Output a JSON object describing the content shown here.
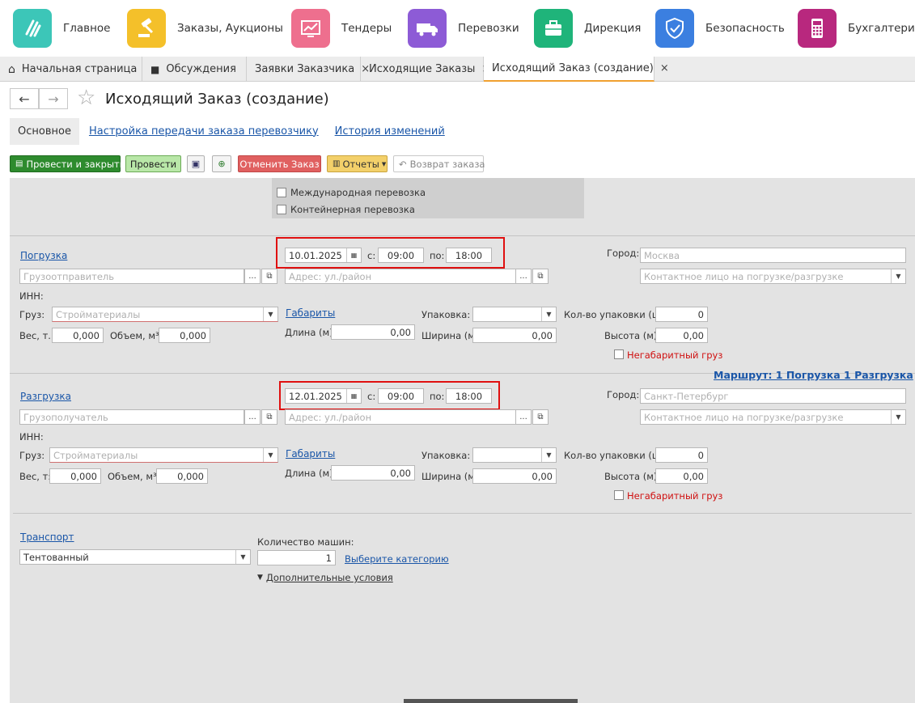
{
  "topnav": {
    "items": [
      {
        "label": "Главное",
        "icon": "main-logo-icon",
        "color": "#3cc6b8"
      },
      {
        "label": "Заказы, Аукционы",
        "icon": "gavel-icon",
        "color": "#f4c02a"
      },
      {
        "label": "Тендеры",
        "icon": "chart-icon",
        "color": "#ee6f8e"
      },
      {
        "label": "Перевозки",
        "icon": "truck-icon",
        "color": "#8d5bd6"
      },
      {
        "label": "Дирекция",
        "icon": "briefcase-icon",
        "color": "#1fb47a"
      },
      {
        "label": "Безопасность",
        "icon": "shield-icon",
        "color": "#3b7fe0"
      },
      {
        "label": "Бухгалтерия",
        "icon": "calculator-icon",
        "color": "#b8287e"
      }
    ]
  },
  "tabs": [
    {
      "label": "Начальная страница",
      "icon": "home-icon"
    },
    {
      "label": "Обсуждения",
      "icon": "chat-icon"
    },
    {
      "label": "Заявки Заказчика",
      "close": "×"
    },
    {
      "label": "Исходящие Заказы",
      "close": "×"
    },
    {
      "label": "Исходящий Заказ (создание)",
      "close": "×",
      "active": true
    }
  ],
  "header": {
    "title": "Исходящий Заказ (создание)",
    "back": "←",
    "forward": "→",
    "star": "☆"
  },
  "subtabs": [
    "Основное",
    "Настройка передачи заказа перевозчику",
    "История изменений"
  ],
  "toolbar": {
    "post_close": "Провести и закрыть",
    "post": "Провести",
    "cancel_order": "Отменить Заказ",
    "reports": "Отчеты",
    "return_order": "Возврат заказа"
  },
  "options": {
    "international": "Международная перевозка",
    "container": "Контейнерная перевозка"
  },
  "loading": {
    "section_label": "Погрузка",
    "date": "10.01.2025",
    "from_label": "с:",
    "from": "09:00",
    "to_label": "по:",
    "to": "18:00",
    "city_label": "Город:",
    "city_placeholder": "Москва",
    "party_placeholder": "Грузоотправитель",
    "address_placeholder": "Адрес: ул./район",
    "contact_placeholder": "Контактное лицо на погрузке/разгрузке",
    "inn_label": "ИНН:",
    "cargo_label": "Груз:",
    "cargo_placeholder": "Стройматериалы",
    "dims_link": "Габариты",
    "pack_label": "Упаковка:",
    "pack_count_label": "Кол-во упаковки (шт):",
    "pack_count": "0",
    "weight_label": "Вес, т.:",
    "weight": "0,000",
    "volume_label": "Объем, м³:",
    "volume": "0,000",
    "length_label": "Длина (м):",
    "length": "0,00",
    "width_label": "Ширина (м):",
    "width": "0,00",
    "height_label": "Высота (м):",
    "height": "0,00",
    "oversize_label": "Негабаритный груз"
  },
  "route_link": "Маршрут:  1 Погрузка  1 Разгрузка",
  "unloading": {
    "section_label": "Разгрузка",
    "date": "12.01.2025",
    "from_label": "с:",
    "from": "09:00",
    "to_label": "по:",
    "to": "18:00",
    "city_label": "Город:",
    "city_placeholder": "Санкт-Петербург",
    "party_placeholder": "Грузополучатель",
    "address_placeholder": "Адрес: ул./район",
    "contact_placeholder": "Контактное лицо на погрузке/разгрузке",
    "inn_label": "ИНН:",
    "cargo_label": "Груз:",
    "cargo_placeholder": "Стройматериалы",
    "dims_link": "Габариты",
    "pack_label": "Упаковка:",
    "pack_count_label": "Кол-во упаковки (шт):",
    "pack_count": "0",
    "weight_label": "Вес, т:",
    "weight": "0,000",
    "volume_label": "Объем, м³:",
    "volume": "0,000",
    "length_label": "Длина (м):",
    "length": "0,00",
    "width_label": "Ширина (м):",
    "width": "0,00",
    "height_label": "Высота (м):",
    "height": "0,00",
    "oversize_label": "Негабаритный груз"
  },
  "transport": {
    "section_label": "Транспорт",
    "type": "Тентованный",
    "count_label": "Количество машин:",
    "count": "1",
    "category_link": "Выберите категорию",
    "extra_link": "Дополнительные условия"
  }
}
